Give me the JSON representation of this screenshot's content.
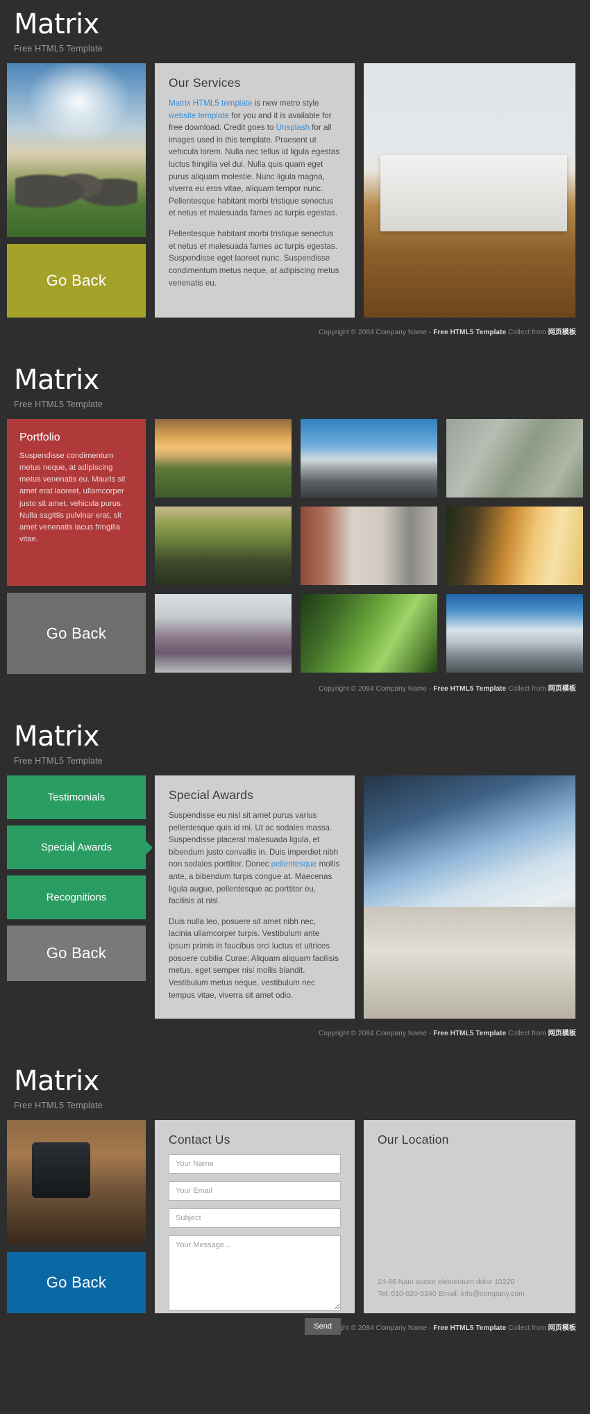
{
  "brand": {
    "logo": "Matrix",
    "tagline": "Free HTML5 Template"
  },
  "footer": {
    "prefix": "Copyright © 2084 Company Name - ",
    "bold": "Free HTML5 Template",
    "middle": " Collect from ",
    "cn": "网页模板"
  },
  "colors": {
    "page_bg": "#2e2e2e",
    "panel_bg": "#cfcfcf",
    "accent_link": "#3c8dd4",
    "goback_olive": "#a4a228",
    "goback_gray": "#6e6e6e",
    "goback_gray2": "#797979",
    "goback_blue": "#0a68a4",
    "portfolio_red": "#b03a3a",
    "tab_green": "#2a9d63",
    "send_gray": "#5e5e5e"
  },
  "services": {
    "title": "Our Services",
    "p1_link1": "Matrix HTML5 template",
    "p1_a": " is new metro style ",
    "p1_link2": "website template",
    "p1_b": " for you and it is available for free download. Credit goes to ",
    "p1_link3": "Unsplash",
    "p1_c": " for all images used in this template. Praesent ut vehicula lorem. Nulla nec tellus id ligula egestas luctus fringilla vel dui. Nulla quis quam eget purus aliquam molestie. Nunc ligula magna, viverra eu eros vitae, aliquam tempor nunc. Pellentesque habitant morbi tristique senectus et netus et malesuada fames ac turpis egestas.",
    "p2": "Pellentesque habitant morbi tristique senectus et netus et malesuada fames ac turpis egestas. Suspendisse eget laoreet nunc. Suspendisse condimentum metus neque, at adipiscing metus venenatis eu."
  },
  "portfolio": {
    "title": "Portfolio",
    "body": "Suspendisse condimentum metus neque, at adipiscing metus venenatis eu. Mauris sit amet erat laoreet, ullamcorper justo sit amet, vehicula purus. Nulla sagittis pulvinar erat, sit amet venenatis lacus fringilla vitae.",
    "items": [
      {
        "name": "sunset-field"
      },
      {
        "name": "wind-turbines-road"
      },
      {
        "name": "weathered-planks"
      },
      {
        "name": "mossy-log"
      },
      {
        "name": "red-tricycle"
      },
      {
        "name": "girl-in-sunlight"
      },
      {
        "name": "foggy-trees"
      },
      {
        "name": "leaf-water-drop"
      },
      {
        "name": "snow-mountains"
      }
    ]
  },
  "awards": {
    "tabs": [
      {
        "label": "Testimonials",
        "active": false
      },
      {
        "label": "Special Awards",
        "active": true
      },
      {
        "label": "Recognitions",
        "active": false
      }
    ],
    "title": "Special Awards",
    "p1_a": "Suspendisse eu nisl sit amet purus varius pellentesque quis id mi. Ut ac sodales massa. Suspendisse placerat malesuada ligula, et bibendum justo convallis in. Duis imperdiet nibh non sodales porttitor. Donec ",
    "p1_link": "pellentesque",
    "p1_b": " mollis ante, a bibendum turpis congue at. Maecenas ligula augue, pellentesque ac porttitor eu, facilisis at nisl.",
    "p2": "Duis nulla leo, posuere sit amet nibh nec, lacinia ullamcorper turpis. Vestibulum ante ipsum primis in faucibus orci luctus et ultrices posuere cubilia Curae; Aliquam aliquam facilisis metus, eget semper nisi mollis blandit. Vestibulum metus neque, vestibulum nec tempus vitae, viverra sit amet odio."
  },
  "contact": {
    "title": "Contact Us",
    "name_placeholder": "Your Name",
    "email_placeholder": "Your Email",
    "subject_placeholder": "Subject",
    "message_placeholder": "Your Message...",
    "send_label": "Send"
  },
  "location": {
    "title": "Our Location",
    "address": "24-66 Nam auctor elementum dolor 10220",
    "contact_line": "Tel: 010-020-0340 Email: info@company.com"
  },
  "buttons": {
    "go_back": "Go Back"
  }
}
